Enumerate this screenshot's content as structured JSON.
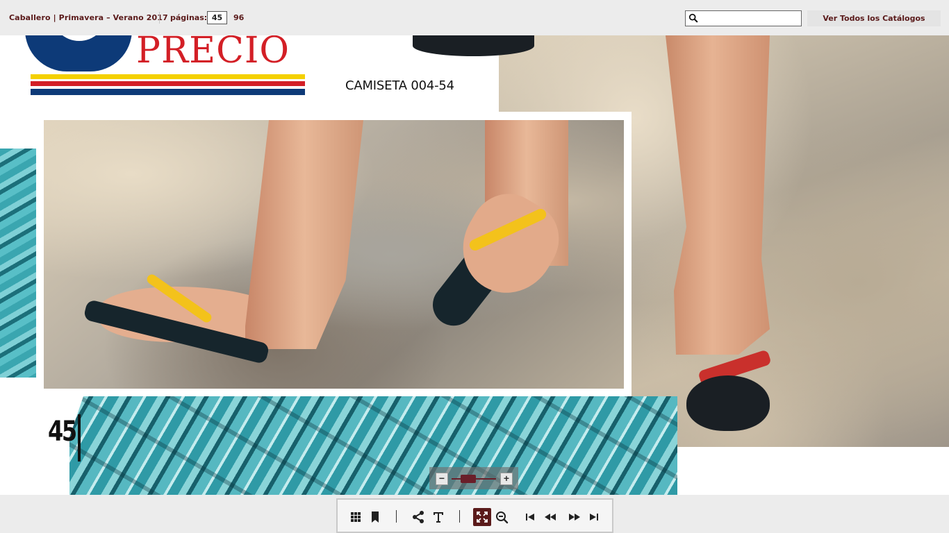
{
  "header": {
    "catalog_title": "Caballero | Primavera – Verano 2017",
    "pages_label": "páginas:",
    "current_page": "45",
    "total_pages": "96",
    "search_placeholder": "",
    "all_catalogs_label": "Ver Todos los Catálogos"
  },
  "page": {
    "logo_text": "PRECIO",
    "product_code": "CAMISETA 004-54",
    "page_number": "45"
  },
  "zoom": {
    "minus_label": "−",
    "plus_label": "+",
    "level": 0.3
  },
  "toolbar": {
    "icons": [
      "grid-icon",
      "bookmark-icon",
      "share-icon",
      "text-icon",
      "fullscreen-icon",
      "zoom-out-icon",
      "first-page-icon",
      "previous-page-icon",
      "next-page-icon",
      "last-page-icon"
    ]
  },
  "colors": {
    "accent": "#5a1a1a",
    "logo_blue": "#0d3a78",
    "logo_red": "#d31f26",
    "logo_yellow": "#f4d000"
  }
}
